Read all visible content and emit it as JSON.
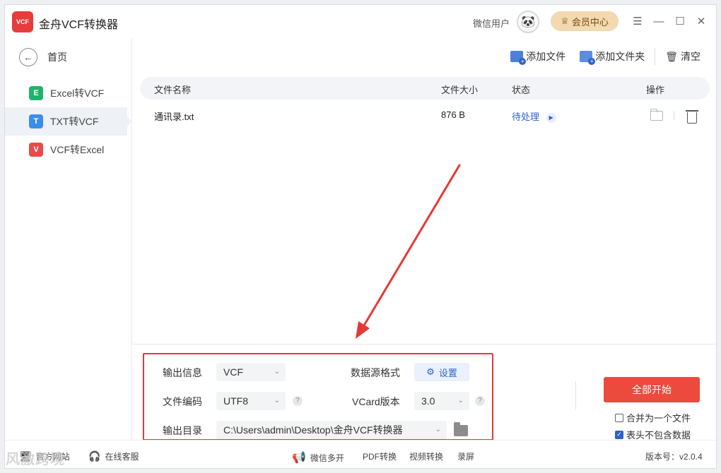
{
  "app": {
    "title": "金舟VCF转换器",
    "logo_text": "VCF",
    "user_name": "微信用户",
    "vip_label": "会员中心"
  },
  "window_controls": {
    "menu": "☰",
    "minimize": "—",
    "maximize": "☐",
    "close": "✕"
  },
  "sidebar": {
    "home_label": "首页",
    "items": [
      {
        "badge": "E",
        "label": "Excel转VCF",
        "color": "#21b36b"
      },
      {
        "badge": "T",
        "label": "TXT转VCF",
        "color": "#3b8ee8"
      },
      {
        "badge": "V",
        "label": "VCF转Excel",
        "color": "#e84a4a"
      }
    ]
  },
  "toolbar": {
    "add_file": "添加文件",
    "add_folder": "添加文件夹",
    "clear": "清空"
  },
  "table": {
    "headers": {
      "name": "文件名称",
      "size": "文件大小",
      "status": "状态",
      "actions": "操作"
    },
    "rows": [
      {
        "name": "通讯录.txt",
        "size": "876 B",
        "status": "待处理"
      }
    ]
  },
  "settings": {
    "output_info_label": "输出信息",
    "output_info_value": "VCF",
    "source_format_label": "数据源格式",
    "source_format_button": "设置",
    "encoding_label": "文件编码",
    "encoding_value": "UTF8",
    "vcard_label": "VCard版本",
    "vcard_value": "3.0",
    "output_dir_label": "输出目录",
    "output_dir_value": "C:\\Users\\admin\\Desktop\\金舟VCF转换器",
    "help_mark": "?"
  },
  "actions": {
    "start_all": "全部开始",
    "merge_label": "合并为一个文件",
    "merge_checked": false,
    "no_header_label": "表头不包含数据",
    "no_header_checked": true
  },
  "footer": {
    "website": "官方网站",
    "support": "在线客服",
    "wechat_multi": "微信多开",
    "pdf_convert": "PDF转换",
    "video_convert": "视频转换",
    "record": "录屏",
    "version": "版本号：v2.0.4",
    "watermark": "风激跨境"
  },
  "colors": {
    "accent": "#2e62c9",
    "start_button": "#ec4a3d",
    "annotation": "#e53935",
    "vip": "#f3d9b0"
  }
}
